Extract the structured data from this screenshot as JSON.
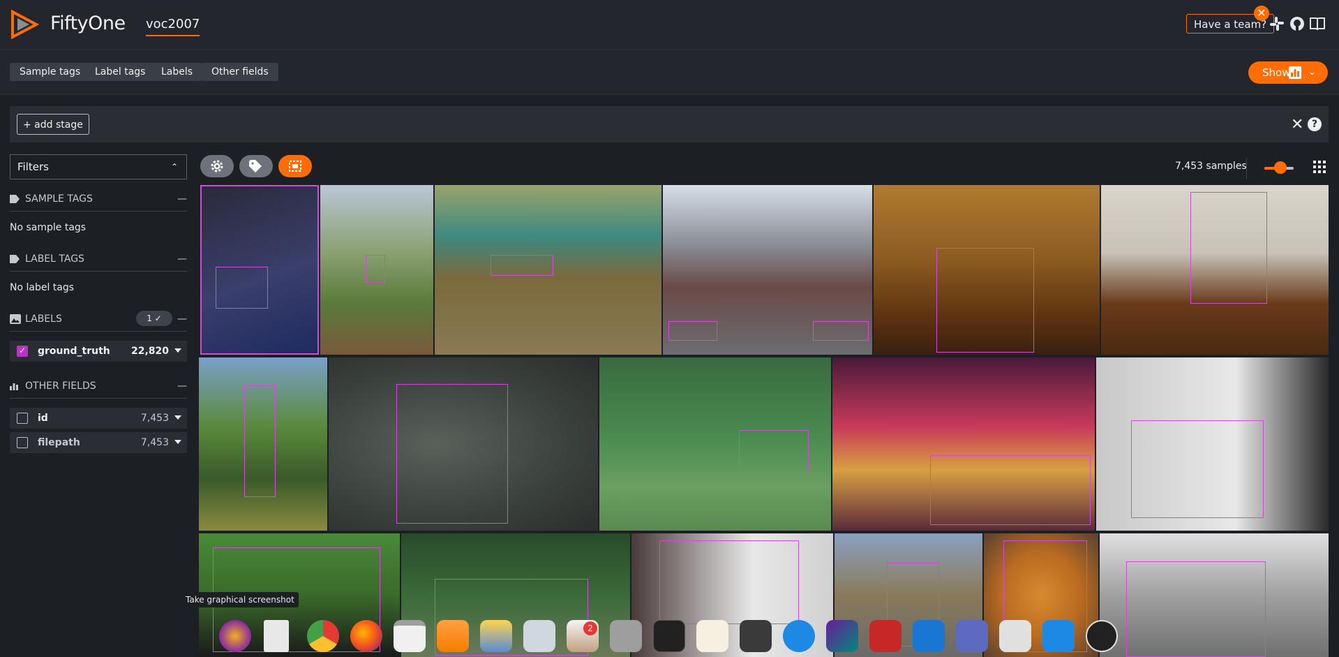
{
  "app": {
    "brand": "FiftyOne",
    "dataset": "voc2007"
  },
  "header": {
    "team_button": "Have a team?",
    "close_glyph": "✕"
  },
  "tag_bar": {
    "pills": [
      "Sample tags",
      "Label tags",
      "Labels",
      "Other fields"
    ],
    "show_button": "Show"
  },
  "stage_bar": {
    "add_stage": "+ add stage",
    "close_glyph": "✕",
    "help_glyph": "?"
  },
  "sidebar": {
    "filters_label": "Filters",
    "sections": {
      "sample_tags": {
        "title": "SAMPLE TAGS",
        "empty": "No sample tags"
      },
      "label_tags": {
        "title": "LABEL TAGS",
        "empty": "No label tags"
      },
      "labels": {
        "title": "LABELS",
        "badge": "1 ✓",
        "fields": [
          {
            "name": "ground_truth",
            "count": "22,820",
            "checked": true
          }
        ]
      },
      "other_fields": {
        "title": "OTHER FIELDS",
        "fields": [
          {
            "name": "id",
            "count": "7,453",
            "checked": false
          },
          {
            "name": "filepath",
            "count": "7,453",
            "checked": false
          }
        ]
      }
    },
    "minus_glyph": "—"
  },
  "grid": {
    "sample_count": "7,453 samples",
    "zoom_level": 0.55,
    "accent": "#ff6d04",
    "box_color": "#d24bd8"
  },
  "dock": {
    "tooltip": "Take graphical screenshot",
    "badge_count": "2",
    "icons": [
      "flameshot-icon",
      "files-icon",
      "chrome-icon",
      "firefox-icon",
      "calendar-icon",
      "music-icon",
      "photos-icon",
      "toggle-icon",
      "appstore-icon",
      "home-folder-icon",
      "terminal-icon",
      "code-braces-icon",
      "sublime-icon",
      "bluetooth-icon",
      "datagrip-icon",
      "filezilla-icon",
      "text-editor-icon",
      "teams-icon",
      "disk-utility-icon",
      "vscode-icon",
      "obs-icon"
    ]
  }
}
